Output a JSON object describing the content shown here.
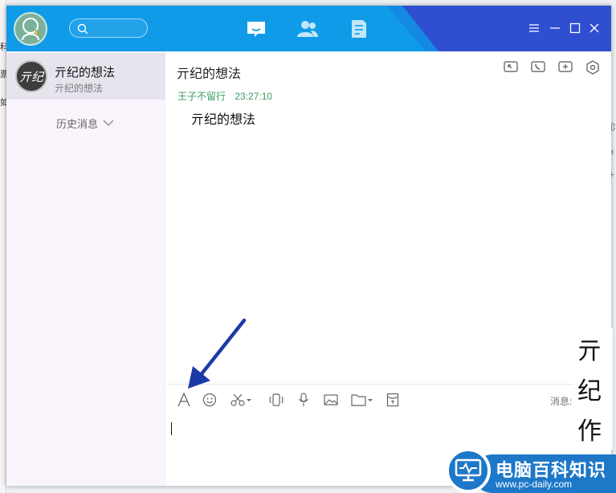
{
  "background": {
    "left_fragments": [
      "科",
      "票",
      "如"
    ],
    "right_fragments": [
      "⇳",
      "×",
      "+"
    ]
  },
  "titlebar": {
    "search_placeholder": "",
    "tabs": [
      {
        "name": "message-tab",
        "icon": "message-icon",
        "active": true
      },
      {
        "name": "contacts-tab",
        "icon": "contacts-icon",
        "active": false
      },
      {
        "name": "apps-tab",
        "icon": "document-icon",
        "active": false
      }
    ],
    "window_buttons": [
      "menu-icon",
      "minimize-icon",
      "maximize-icon",
      "close-icon"
    ]
  },
  "sidebar": {
    "contact": {
      "avatar_text": "亓纪",
      "name": "亓纪的想法",
      "subtitle": "亓纪的想法"
    },
    "history_label": "历史消息"
  },
  "chat": {
    "title": "亓纪的想法",
    "message": {
      "sender": "王子不留行",
      "time": "23:27:10",
      "text": "亓纪的想法"
    }
  },
  "toolbar": {
    "tools": [
      "font-icon",
      "emoji-icon",
      "screenshot-icon",
      "shake-icon",
      "voice-icon",
      "image-icon",
      "folder-icon",
      "redpacket-icon"
    ],
    "hint": "消息:"
  },
  "watermark": {
    "chars": [
      "亓",
      "纪",
      "作"
    ],
    "brand": "电脑百科知识",
    "url": "www.pc-daily.com"
  },
  "colors": {
    "titlebar": "#0f9be8",
    "titlebar_dark": "#2f4ed0",
    "sender": "#3a9b66",
    "arrow": "#1b3aa6"
  }
}
